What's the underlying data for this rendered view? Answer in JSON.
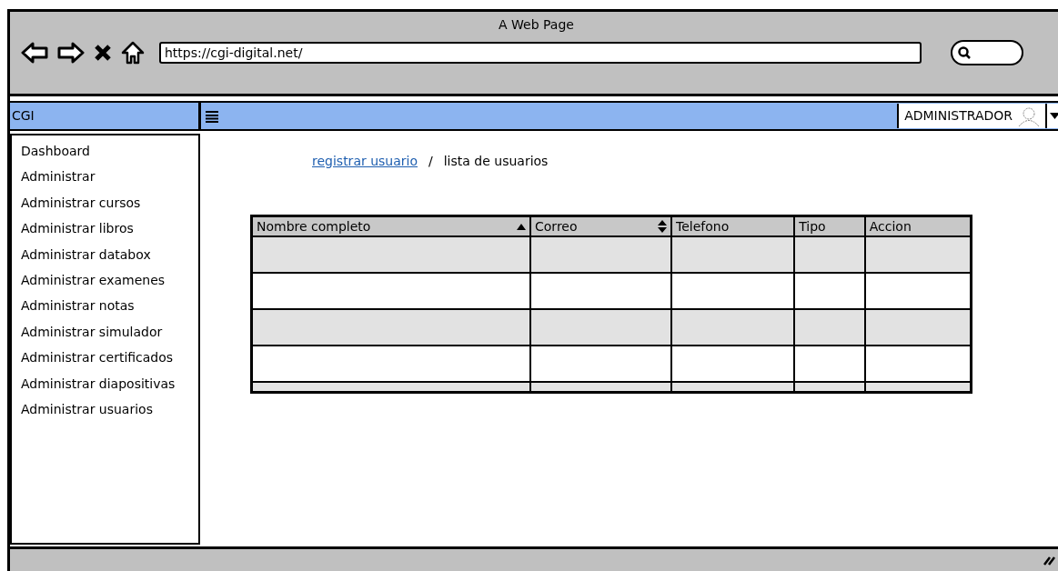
{
  "window": {
    "title": "A Web Page",
    "url": "https://cgi-digital.net/"
  },
  "navbar": {
    "brand": "CGI",
    "user": "ADMINISTRADOR"
  },
  "sidebar": {
    "items": [
      {
        "label": "Dashboard"
      },
      {
        "label": "Administrar"
      },
      {
        "label": "Administrar cursos"
      },
      {
        "label": "Administrar libros"
      },
      {
        "label": "Administrar databox"
      },
      {
        "label": "Administrar examenes"
      },
      {
        "label": "Administrar notas"
      },
      {
        "label": "Administrar simulador"
      },
      {
        "label": "Administrar certificados"
      },
      {
        "label": "Administrar diapositivas"
      },
      {
        "label": "Administrar usuarios"
      }
    ]
  },
  "breadcrumb": {
    "link": "registrar usuario",
    "separator": "/",
    "current": "lista de usuarios"
  },
  "table": {
    "columns": [
      {
        "label": "Nombre completo",
        "kind": "ascending"
      },
      {
        "label": "Correo",
        "kind": "sortable"
      },
      {
        "label": "Telefono",
        "kind": "plain"
      },
      {
        "label": "Tipo",
        "kind": "plain"
      },
      {
        "label": "Accion",
        "kind": "plain"
      }
    ],
    "rows": [
      {
        "shaded": true
      },
      {
        "shaded": false
      },
      {
        "shaded": true
      },
      {
        "shaded": false
      },
      {
        "shaded": true
      }
    ]
  }
}
